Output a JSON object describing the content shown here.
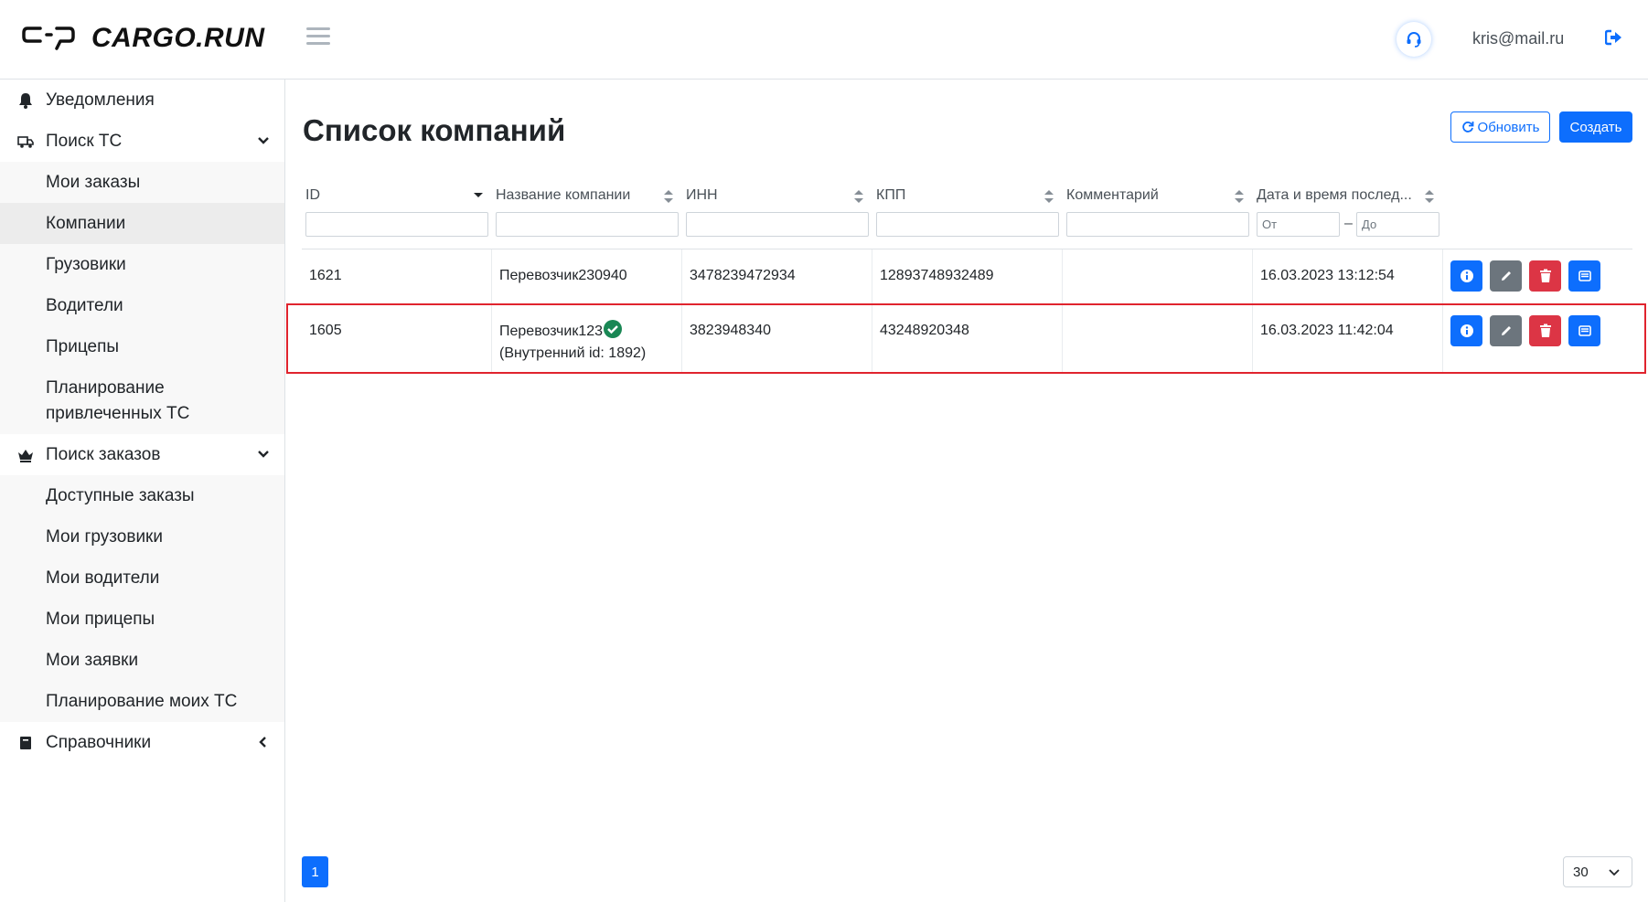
{
  "header": {
    "logo_text": "CARGO.RUN",
    "user_email": "kris@mail.ru"
  },
  "sidebar": {
    "items": [
      {
        "label": "Уведомления",
        "icon": "bell-icon"
      },
      {
        "label": "Поиск ТС",
        "icon": "truck-icon",
        "expanded": true,
        "children": [
          "Мои заказы",
          "Компании",
          "Грузовики",
          "Водители",
          "Прицепы",
          "Планирование привлеченных ТС"
        ]
      },
      {
        "label": "Поиск заказов",
        "icon": "crown-icon",
        "expanded": true,
        "children": [
          "Доступные заказы",
          "Мои грузовики",
          "Мои водители",
          "Мои прицепы",
          "Мои заявки",
          "Планирование моих ТС"
        ]
      },
      {
        "label": "Справочники",
        "icon": "book-icon",
        "expanded": false
      }
    ],
    "active": "Компании"
  },
  "main": {
    "title": "Список компаний",
    "refresh_label": "Обновить",
    "create_label": "Создать"
  },
  "table": {
    "columns": [
      "ID",
      "Название компании",
      "ИНН",
      "КПП",
      "Комментарий",
      "Дата и время послед..."
    ],
    "date_filter_from": "От",
    "date_filter_to": "До",
    "rows": [
      {
        "id": "1621",
        "name": "Перевозчик230940",
        "name_sub": "",
        "inn": "3478239472934",
        "kpp": "12893748932489",
        "comment": "",
        "datetime": "16.03.2023 13:12:54"
      },
      {
        "id": "1605",
        "name": "Перевозчик123",
        "name_sub": "(Внутренний id: 1892)",
        "inn": "3823948340",
        "kpp": "43248920348",
        "comment": "",
        "datetime": "16.03.2023 11:42:04",
        "verified": true
      }
    ]
  },
  "pagination": {
    "current_page": "1",
    "page_size": "30"
  },
  "colors": {
    "primary": "#0d6efd",
    "danger": "#dc3545",
    "secondary": "#6c757d",
    "highlight": "#e0242e",
    "verified": "#198754"
  }
}
